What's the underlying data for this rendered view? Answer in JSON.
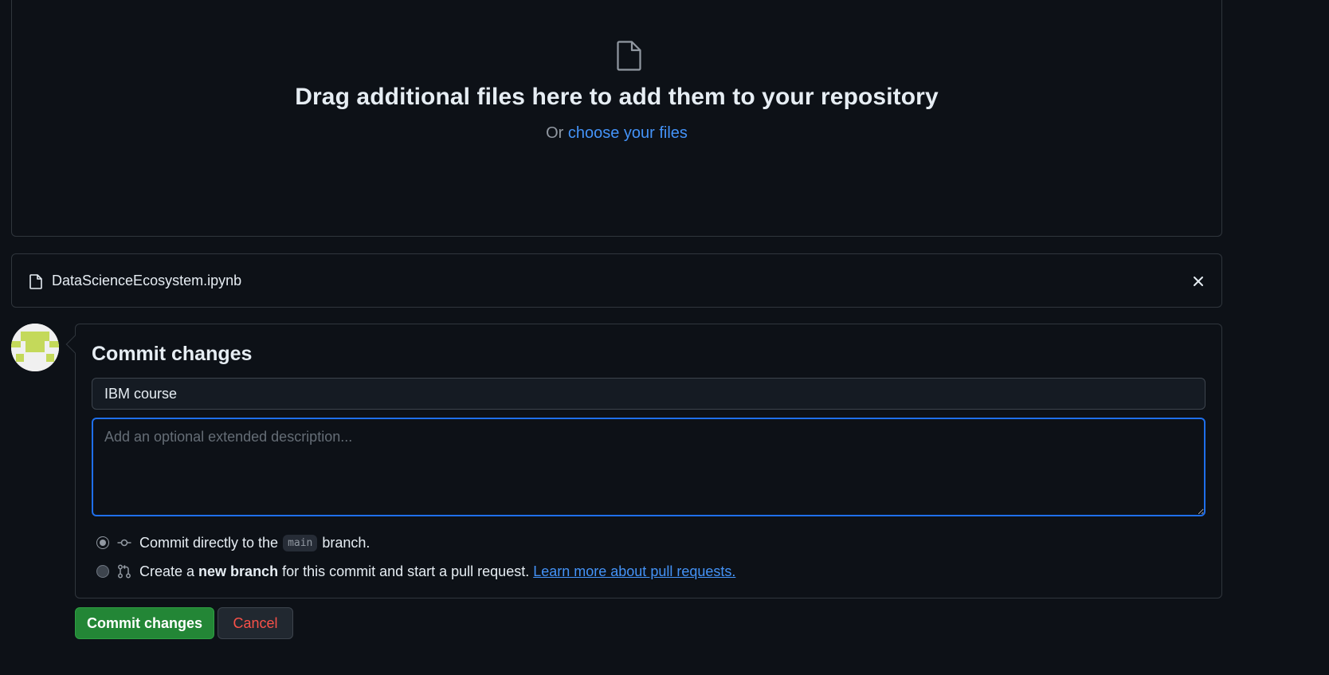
{
  "dropzone": {
    "icon": "file-icon",
    "title": "Drag additional files here to add them to your repository",
    "or_text": "Or",
    "choose_link": "choose your files"
  },
  "uploaded_files": [
    {
      "name": "DataScienceEcosystem.ipynb",
      "icon": "file-icon",
      "remove_icon": "x-icon"
    }
  ],
  "commit": {
    "title": "Commit changes",
    "summary_value": "IBM course",
    "description_placeholder": "Add an optional extended description...",
    "options": {
      "direct": {
        "checked": true,
        "icon": "git-commit-icon",
        "text_before": "Commit directly to the",
        "branch": "main",
        "text_after": "branch."
      },
      "new_branch": {
        "checked": false,
        "icon": "git-pull-request-icon",
        "text_before": "Create a",
        "bold": "new branch",
        "text_after": "for this commit and start a pull request.",
        "link": "Learn more about pull requests."
      }
    },
    "submit_label": "Commit changes",
    "cancel_label": "Cancel"
  },
  "colors": {
    "background": "#0d1117",
    "border": "#30363d",
    "link": "#4493f8",
    "primary_button": "#238636",
    "danger_text": "#f85149",
    "focus_border": "#1f6feb"
  }
}
